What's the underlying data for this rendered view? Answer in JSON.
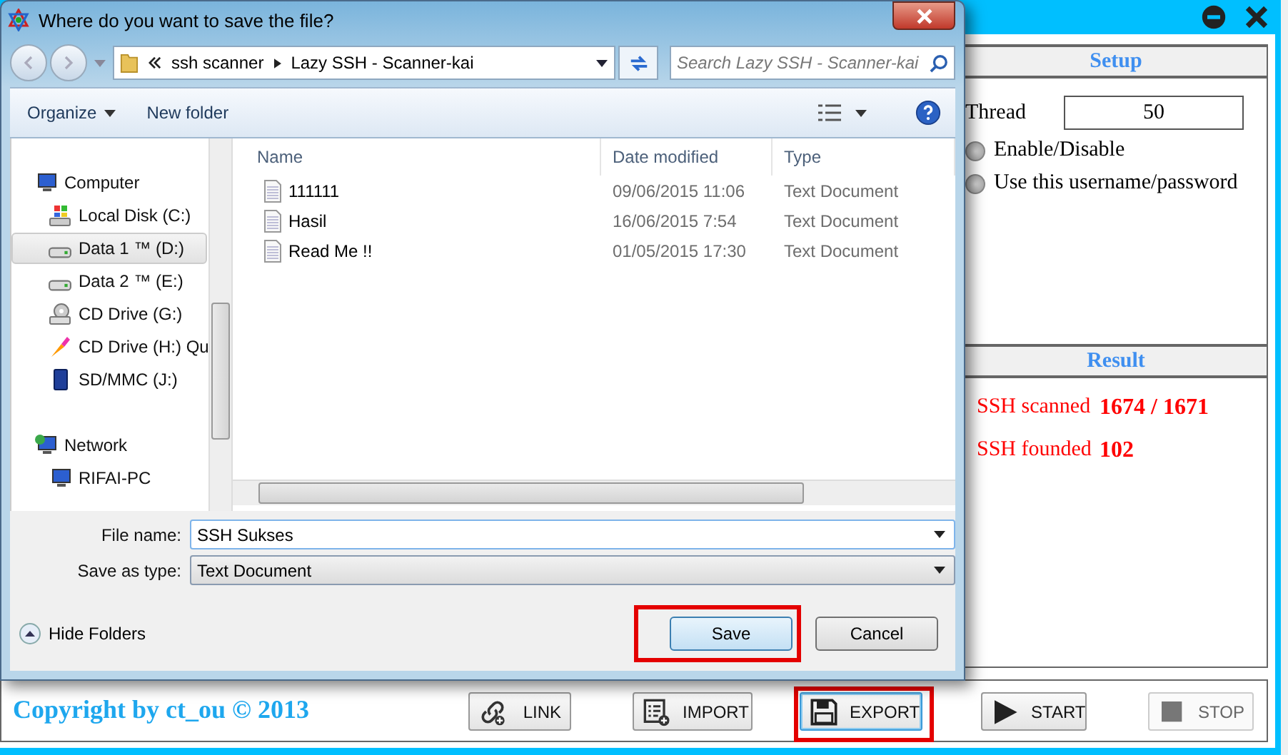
{
  "app": {
    "setup": {
      "title": "Setup",
      "thread_label": "Thread",
      "thread_value": "50",
      "options": [
        {
          "label": "Enable/Disable",
          "selected": false
        },
        {
          "label": "Use this username/password",
          "selected": false
        }
      ]
    },
    "result": {
      "title": "Result",
      "rows": [
        {
          "label": "SSH scanned",
          "value": "1674 / 1671"
        },
        {
          "label": "SSH founded",
          "value": "102"
        }
      ]
    },
    "copyright": "Copyright by ct_ou © 2013",
    "buttons": [
      {
        "kind": "link",
        "label": "LINK",
        "disabled": false,
        "highlighted": false
      },
      {
        "kind": "import",
        "label": "IMPORT",
        "disabled": false,
        "highlighted": false
      },
      {
        "kind": "export",
        "label": "EXPORT",
        "disabled": false,
        "highlighted": true
      },
      {
        "kind": "start",
        "label": "START",
        "disabled": false,
        "highlighted": false
      },
      {
        "kind": "stop",
        "label": "STOP",
        "disabled": true,
        "highlighted": false
      }
    ]
  },
  "dialog": {
    "title": "Where do you want to save the file?",
    "breadcrumb": [
      "ssh scanner",
      "Lazy SSH - Scanner-kai"
    ],
    "search_placeholder": "Search Lazy SSH - Scanner-kai",
    "toolbar": [
      "Organize",
      "New folder"
    ],
    "nav": [
      {
        "kind": "computer",
        "label": "Computer",
        "selected": false,
        "children": [
          {
            "kind": "windisk",
            "label": "Local Disk (C:)",
            "selected": false
          },
          {
            "kind": "disk",
            "label": "Data 1 ™ (D:)",
            "selected": true
          },
          {
            "kind": "disk",
            "label": "Data 2 ™ (E:)",
            "selected": false
          },
          {
            "kind": "cd",
            "label": "CD Drive (G:)",
            "selected": false
          },
          {
            "kind": "appcd",
            "label": "CD Drive (H:) Qu",
            "selected": false
          },
          {
            "kind": "sd",
            "label": "SD/MMC (J:)",
            "selected": false
          }
        ]
      },
      {
        "kind": "network",
        "label": "Network",
        "selected": false,
        "children": [
          {
            "kind": "computer",
            "label": "RIFAI-PC",
            "selected": false
          }
        ]
      }
    ],
    "columns": [
      "Name",
      "Date modified",
      "Type"
    ],
    "files": [
      {
        "name": "111111",
        "date": "09/06/2015 11:06",
        "type": "Text Document"
      },
      {
        "name": "Hasil",
        "date": "16/06/2015 7:54",
        "type": "Text Document"
      },
      {
        "name": "Read Me !!",
        "date": "01/05/2015 17:30",
        "type": "Text Document"
      }
    ],
    "file_name_label": "File name:",
    "file_name": "SSH Sukses",
    "type_label": "Save as type:",
    "save_as_type": "Text Document",
    "hide_folders": "Hide Folders",
    "buttons": [
      {
        "label": "Save",
        "highlighted": true
      },
      {
        "label": "Cancel",
        "highlighted": false
      }
    ]
  }
}
